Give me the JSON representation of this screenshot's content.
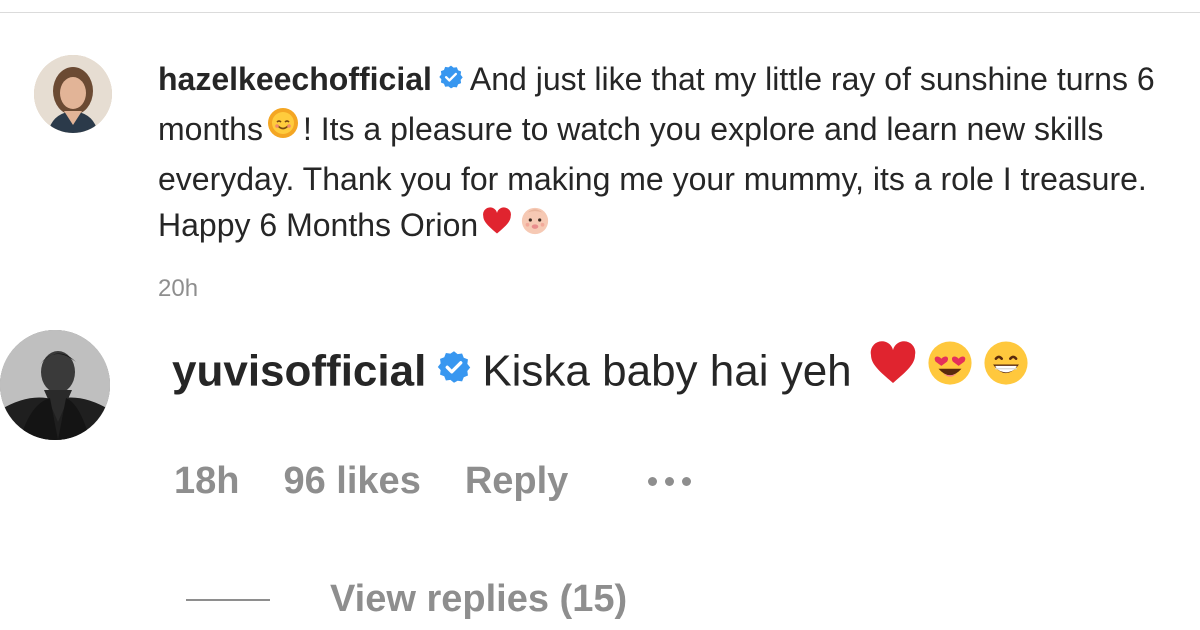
{
  "post": {
    "author": {
      "username": "hazelkeechofficial",
      "verified": true
    },
    "caption_parts": [
      "And just like that my little ray of sunshine turns 6 months",
      "! Its a pleasure to watch you explore and learn new skills everyday. Thank you for making me your mummy, its a role I treasure. Happy 6 Months Orion"
    ],
    "caption_emojis": [
      "sun-with-face",
      "red-heart",
      "baby"
    ],
    "time": "20h"
  },
  "comment": {
    "author": {
      "username": "yuvisofficial",
      "verified": true
    },
    "text": "Kiska baby hai yeh",
    "emojis": [
      "red-heart",
      "smiling-face-with-heart-eyes",
      "beaming-face-with-smiling-eyes"
    ],
    "time": "18h",
    "likes": "96 likes",
    "reply_label": "Reply",
    "view_replies_label": "View replies (15)"
  },
  "colors": {
    "text": "#262626",
    "secondary": "#8e8e8e",
    "verified": "#3897f0",
    "heart": "#e0242f"
  }
}
